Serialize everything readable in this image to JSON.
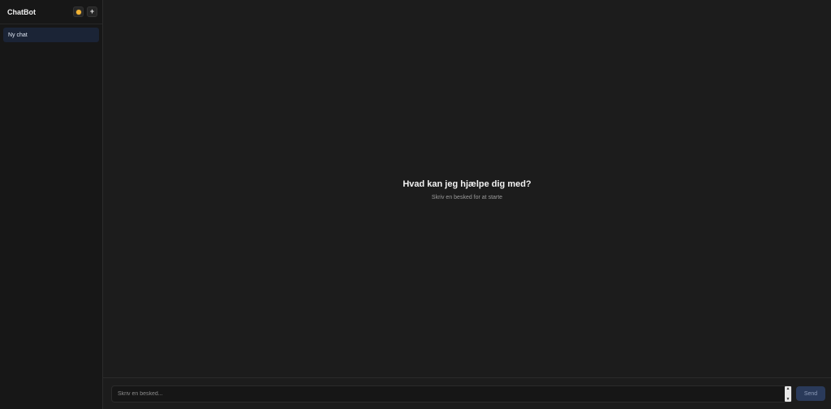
{
  "sidebar": {
    "title": "ChatBot",
    "theme_button_icon": "sun-icon",
    "new_chat_button_icon": "plus-icon",
    "new_chat_glyph": "+",
    "chats": [
      {
        "label": "Ny chat",
        "active": true
      }
    ]
  },
  "main": {
    "welcome_title": "Hvad kan jeg hjælpe dig med?",
    "welcome_subtitle": "Skriv en besked for at starte"
  },
  "composer": {
    "placeholder": "Skriv en besked...",
    "value": "",
    "send_label": "Send"
  },
  "colors": {
    "accent": "#2a3a5a",
    "active_chat_bg": "#1b2436",
    "sun": "#f2b233"
  }
}
